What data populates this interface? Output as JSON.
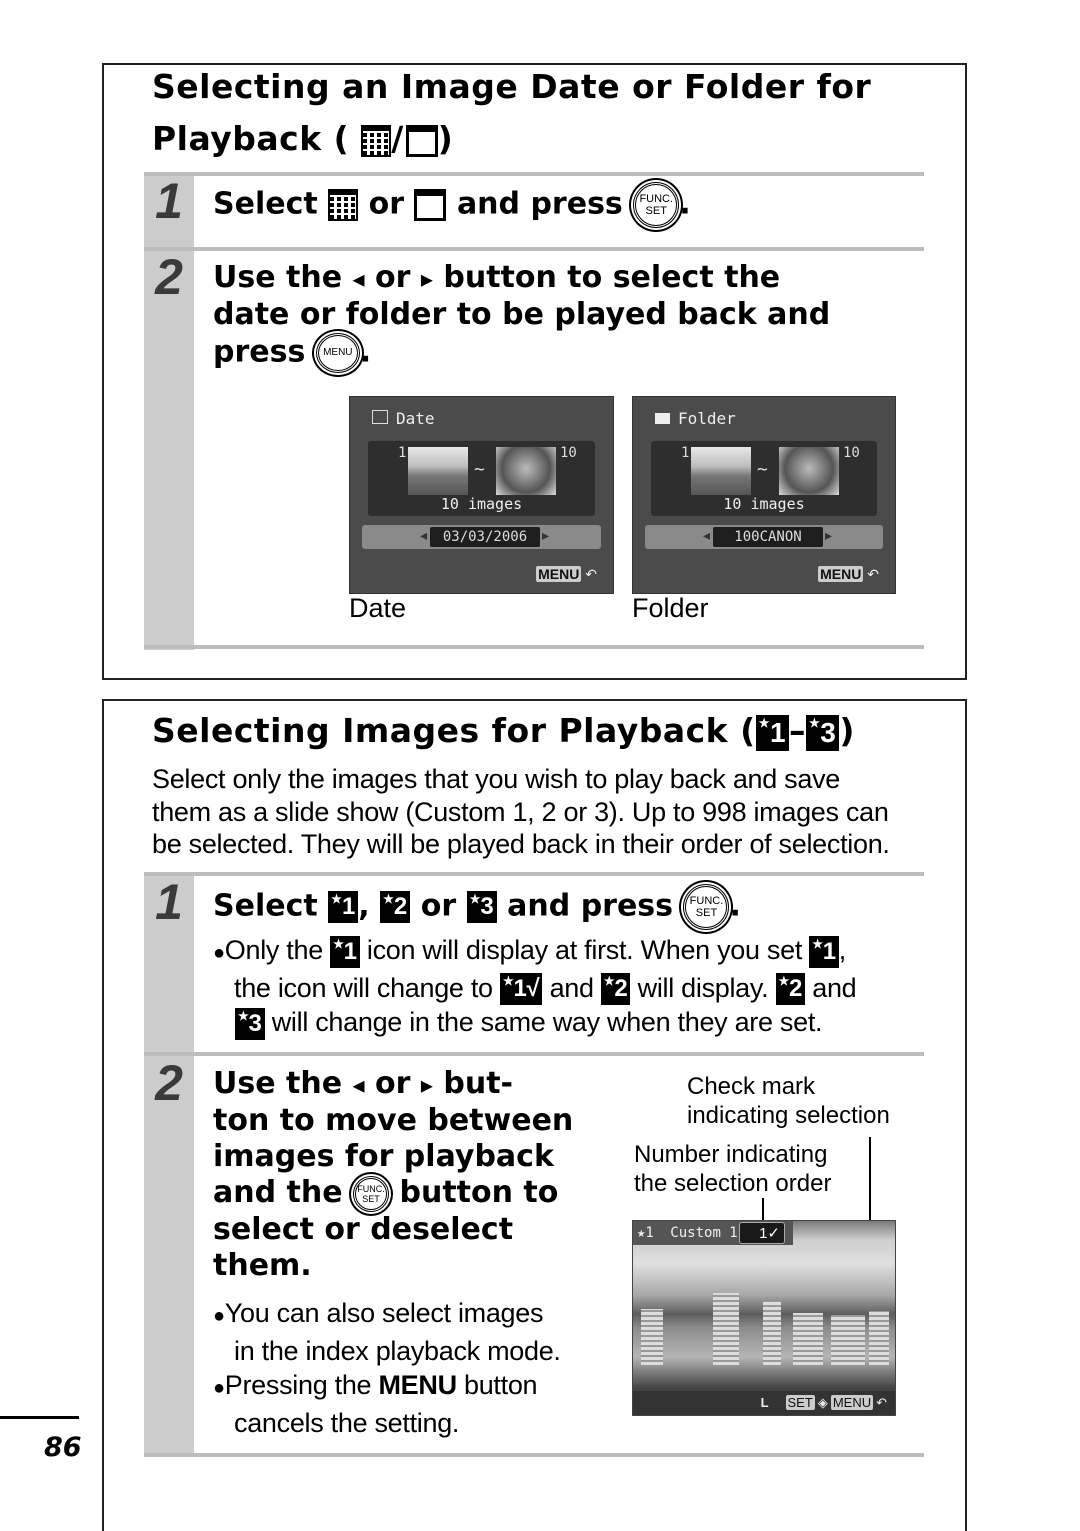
{
  "section1": {
    "title_line1": "Selecting an Image Date or Folder for",
    "title_line2": "Playback (",
    "title_sep": "/",
    "title_close": ")",
    "step1": {
      "number": "1",
      "text_select": "Select",
      "text_or": "or",
      "text_and_press": "and press",
      "text_period": "."
    },
    "step2": {
      "number": "2",
      "text_line1a": "Use the",
      "text_or": "or",
      "text_line1b": "button to select the",
      "text_line2": "date or folder to be played back and",
      "text_line3": "press",
      "text_period": "."
    },
    "screens": [
      {
        "header": "Date",
        "first_index": "1",
        "last_index": "10",
        "tilde": "~",
        "count": "10 images",
        "selected_value": "03/03/2006",
        "menu_label": "MENU",
        "caption": "Date"
      },
      {
        "header": "Folder",
        "first_index": "1",
        "last_index": "10",
        "tilde": "~",
        "count": "10 images",
        "selected_value": "100CANON",
        "menu_label": "MENU",
        "caption": "Folder"
      }
    ]
  },
  "section2": {
    "title": "Selecting Images for Playback (",
    "title_dash": "–",
    "title_close": ")",
    "intro_lines": [
      "Select only the images that you wish to play back and save",
      "them as a slide show (Custom 1, 2 or 3). Up to 998 images can",
      "be selected. They will be played back in their order of selection."
    ],
    "step1": {
      "number": "1",
      "text_select": "Select",
      "comma": ",",
      "text_or": "or",
      "text_and_press": "and press",
      "text_period": ".",
      "bullet_line1a": "Only the",
      "bullet_line1b": "icon will display at first. When you set",
      "bullet_line1c": ",",
      "bullet_line2a": "the icon will change to",
      "bullet_line2b": "and",
      "bullet_line2c": "will display.",
      "bullet_line2d": "and",
      "bullet_line3": "will change in the same way when they are set."
    },
    "step2": {
      "number": "2",
      "line1a": "Use the",
      "line1_or": "or",
      "line1b": "but-",
      "line2": "ton to move between",
      "line3": "images for playback",
      "line4a": "and the",
      "line4b": "button to",
      "line5": "select or deselect",
      "line6": "them.",
      "bullet1_line1": "You can also select images",
      "bullet1_line2": "in the index playback mode.",
      "bullet2_line1a": "Pressing the",
      "bullet2_line1_bold": "MENU",
      "bullet2_line1b": "button",
      "bullet2_line2": "cancels the setting."
    },
    "callouts": {
      "check_mark_line1": "Check mark",
      "check_mark_line2": "indicating selection",
      "number_line1": "Number indicating",
      "number_line2": "the selection order"
    },
    "photo_screen": {
      "mode_icon": "★1",
      "mode_label": "Custom 1",
      "order_value": "1✓",
      "size_label": "L",
      "set_label": "SET",
      "menu_label": "MENU"
    }
  },
  "icons": {
    "star1": "1",
    "star2": "2",
    "star3": "3",
    "star1_checked": "1√",
    "star_glyph": "★",
    "func_line1": "FUNC.",
    "func_line2": "SET",
    "menu_btn": "MENU",
    "left_arrow": "◂",
    "right_arrow": "▸",
    "return_arrow": "↶",
    "bullet": "●"
  },
  "footer": {
    "page_number": "86"
  }
}
